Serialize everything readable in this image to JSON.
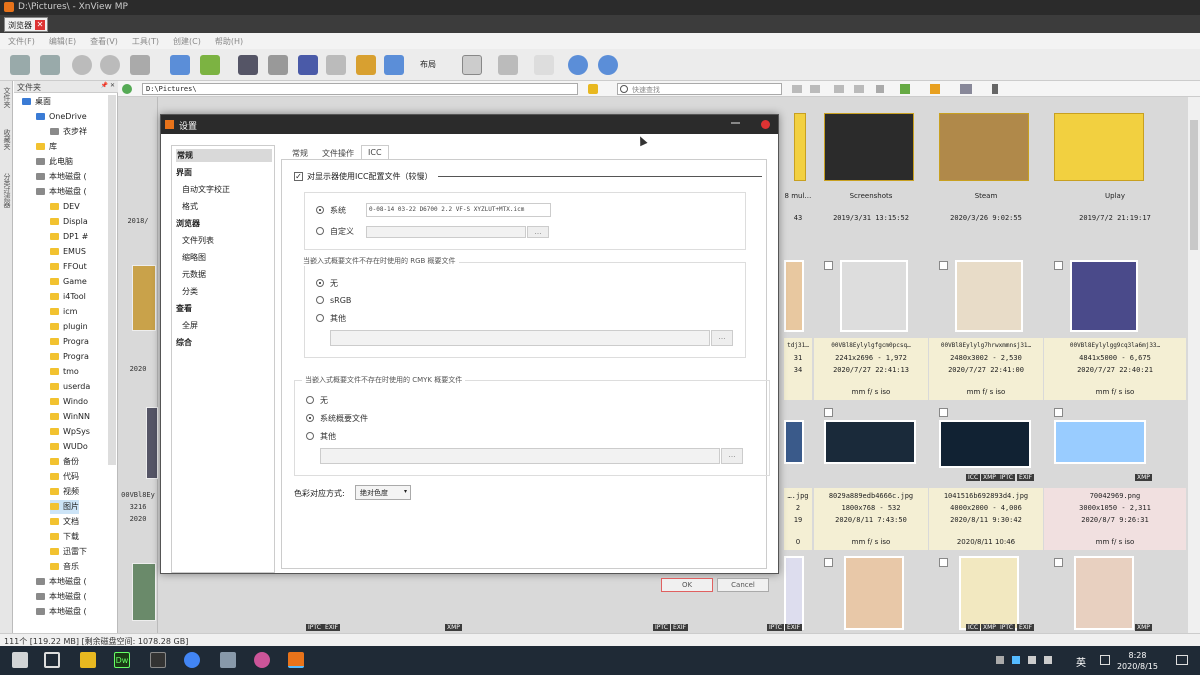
{
  "window": {
    "title": "D:\\Pictures\\ - XnView MP",
    "tab_label": "浏览器",
    "tab_close": "✕"
  },
  "menu": [
    "文件(F)",
    "编辑(E)",
    "查看(V)",
    "工具(T)",
    "创建(C)",
    "帮助(H)"
  ],
  "toolbar": {
    "layout_label": "布局"
  },
  "side_tabs": [
    "文件夹",
    "收藏夹",
    "分类过滤器"
  ],
  "folder_panel": {
    "header": "文件夹",
    "pin": "📌 ✕"
  },
  "tree": [
    {
      "label": "桌面",
      "icon": "blue"
    },
    {
      "label": "OneDrive",
      "icon": "blue"
    },
    {
      "label": "衣步祥",
      "icon": "grey"
    },
    {
      "label": "库",
      "icon": "folder"
    },
    {
      "label": "此电脑",
      "icon": "grey"
    },
    {
      "label": "本地磁盘 (",
      "icon": "grey"
    },
    {
      "label": "本地磁盘 (",
      "icon": "grey"
    },
    {
      "label": "DEV",
      "icon": "folder"
    },
    {
      "label": "Displa",
      "icon": "folder"
    },
    {
      "label": "DP1 #",
      "icon": "folder"
    },
    {
      "label": "EMUS",
      "icon": "folder"
    },
    {
      "label": "FFOut",
      "icon": "folder"
    },
    {
      "label": "Game",
      "icon": "folder"
    },
    {
      "label": "i4Tool",
      "icon": "folder"
    },
    {
      "label": "icm",
      "icon": "folder"
    },
    {
      "label": "plugin",
      "icon": "folder"
    },
    {
      "label": "Progra",
      "icon": "folder"
    },
    {
      "label": "Progra",
      "icon": "folder"
    },
    {
      "label": "tmo",
      "icon": "folder"
    },
    {
      "label": "userda",
      "icon": "folder"
    },
    {
      "label": "Windo",
      "icon": "folder"
    },
    {
      "label": "WinNN",
      "icon": "folder"
    },
    {
      "label": "WpSys",
      "icon": "folder"
    },
    {
      "label": "WUDo",
      "icon": "folder"
    },
    {
      "label": "备份",
      "icon": "folder"
    },
    {
      "label": "代码",
      "icon": "folder"
    },
    {
      "label": "视频",
      "icon": "folder"
    },
    {
      "label": "图片",
      "icon": "folder"
    },
    {
      "label": "文档",
      "icon": "folder"
    },
    {
      "label": "下载",
      "icon": "folder"
    },
    {
      "label": "迅雷下",
      "icon": "folder"
    },
    {
      "label": "音乐",
      "icon": "folder"
    },
    {
      "label": "本地磁盘 (",
      "icon": "grey"
    },
    {
      "label": "本地磁盘 (",
      "icon": "grey"
    },
    {
      "label": "本地磁盘 (",
      "icon": "grey"
    }
  ],
  "address": {
    "path": "D:\\Pictures\\",
    "search_placeholder": "快速查找"
  },
  "thumbnails": {
    "row1": [
      {
        "name": "8 mul…",
        "date": "43"
      },
      {
        "name": "Screenshots",
        "date": "2019/3/31 13:15:52"
      },
      {
        "name": "Steam",
        "date": "2020/3/26 9:02:55"
      },
      {
        "name": "Uplay",
        "date": "2019/7/2 21:19:17"
      }
    ],
    "row2": [
      {
        "name": "tdj31…",
        "dims": "31",
        "date": "34",
        "meta": ""
      },
      {
        "name": "00VBl8Eylylgfgcm0pcsq…",
        "dims": "2241x2696 - 1,972",
        "date": "2020/7/27 22:41:13",
        "meta": "mm f/ s iso"
      },
      {
        "name": "00VBl8Eylylg7hrwxmmnsj31…",
        "dims": "2480x3002 - 2,530",
        "date": "2020/7/27 22:41:00",
        "meta": "mm f/ s iso"
      },
      {
        "name": "00VBl8Eylylgg9cq3la6mj33…",
        "dims": "4841x5000 - 6,675",
        "date": "2020/7/27 22:40:21",
        "meta": "mm f/ s iso"
      }
    ],
    "row3": [
      {
        "name": "….jpg",
        "dims": "2",
        "date": "19",
        "meta": "0"
      },
      {
        "name": "8029a889edb4666c.jpg",
        "dims": "1800x768 - 532",
        "date": "2020/8/11 7:43:50",
        "meta": "mm f/ s iso"
      },
      {
        "name": "1041516b692893d4.jpg",
        "dims": "4000x2000 - 4,006",
        "date": "2020/8/11 9:30:42",
        "meta": "2020/8/11 10:46"
      },
      {
        "name": "70042969.png",
        "dims": "3000x1050 - 2,311",
        "date": "2020/8/7 9:26:31",
        "meta": "mm f/ s iso"
      }
    ],
    "left_partial": {
      "date1": "2018/",
      "date2": "2020",
      "name3": "00VBl8Ey",
      "dims3": "3216",
      "date3": "2020"
    },
    "badges": {
      "xmp": "XMP",
      "iptc": "IPTC",
      "exif": "EXIF",
      "icc": "ICC"
    }
  },
  "status": "111个 [119.22 MB] [剩余磁盘空间: 1078.28 GB]",
  "taskbar": {
    "time": "8:28",
    "date": "2020/8/15",
    "ime": "英",
    "dw": "Dw"
  },
  "dialog": {
    "title": "设置",
    "nav": [
      {
        "label": "常规",
        "kind": "sel"
      },
      {
        "label": "界面",
        "kind": "h"
      },
      {
        "label": "自动文字校正",
        "kind": "s"
      },
      {
        "label": "格式",
        "kind": "s"
      },
      {
        "label": "浏览器",
        "kind": "h"
      },
      {
        "label": "文件列表",
        "kind": "s"
      },
      {
        "label": "缩略图",
        "kind": "s"
      },
      {
        "label": "元数据",
        "kind": "s"
      },
      {
        "label": "分类",
        "kind": "s"
      },
      {
        "label": "查看",
        "kind": "h"
      },
      {
        "label": "全屏",
        "kind": "s"
      },
      {
        "label": "综合",
        "kind": "h"
      }
    ],
    "tabs": [
      "常规",
      "文件操作",
      "ICC"
    ],
    "use_icc_label": "对显示器使用ICC配置文件（较慢）",
    "monitor": {
      "system": "系统",
      "custom": "自定义",
      "profile": "0-08-14 03-22 D6700 2.2 VF-S XYZLUT+MTX.icm",
      "ellipsis": "…"
    },
    "rgb_group": {
      "title": "当嵌入式概要文件不存在时使用的 RGB 概要文件",
      "none": "无",
      "srgb": "sRGB",
      "other": "其他",
      "ellipsis": "…"
    },
    "cmyk_group": {
      "title": "当嵌入式概要文件不存在时使用的 CMYK 概要文件",
      "none": "无",
      "system": "系统概要文件",
      "other": "其他",
      "ellipsis": "…"
    },
    "intent_label": "色彩对应方式:",
    "intent_value": "绝对色度",
    "ok": "OK",
    "cancel": "Cancel"
  }
}
